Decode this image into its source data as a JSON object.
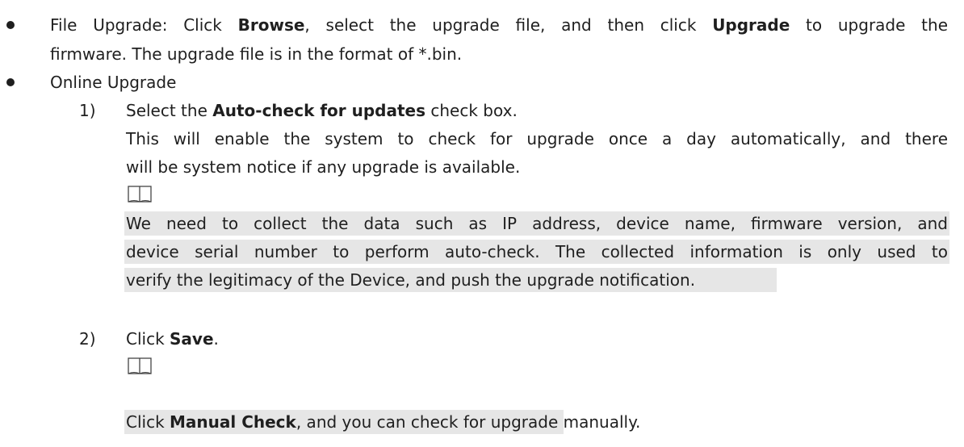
{
  "items": {
    "file_upgrade": {
      "pre": "File Upgrade: Click ",
      "browse": "Browse",
      "mid": ", select the upgrade file, and then click ",
      "upgrade": "Upgrade",
      "post": " to upgrade the",
      "line2": "firmware. The upgrade file is in the format of *.bin."
    },
    "online_upgrade": {
      "label": "Online Upgrade",
      "step1": {
        "num": "1)",
        "pre": "Select the ",
        "bold": "Auto-check for updates",
        "post": " check box.",
        "desc1": "This will enable the system to check for upgrade once a day automatically, and there",
        "desc2": "will be system notice if any upgrade is available.",
        "note_icon": "book-note-icon",
        "note1": "We need to collect the data such as IP address, device name, firmware version, and",
        "note2": "device serial number to perform auto-check. The collected information is only used to",
        "note3": "verify the legitimacy of the Device, and push the upgrade notification."
      },
      "step2": {
        "num": "2)",
        "pre": "Click ",
        "bold": "Save",
        "post": ".",
        "note_icon": "book-note-icon",
        "note_pre": "Click ",
        "note_bold": "Manual Check",
        "note_post": ", and you can check for upgrade manually."
      }
    }
  }
}
